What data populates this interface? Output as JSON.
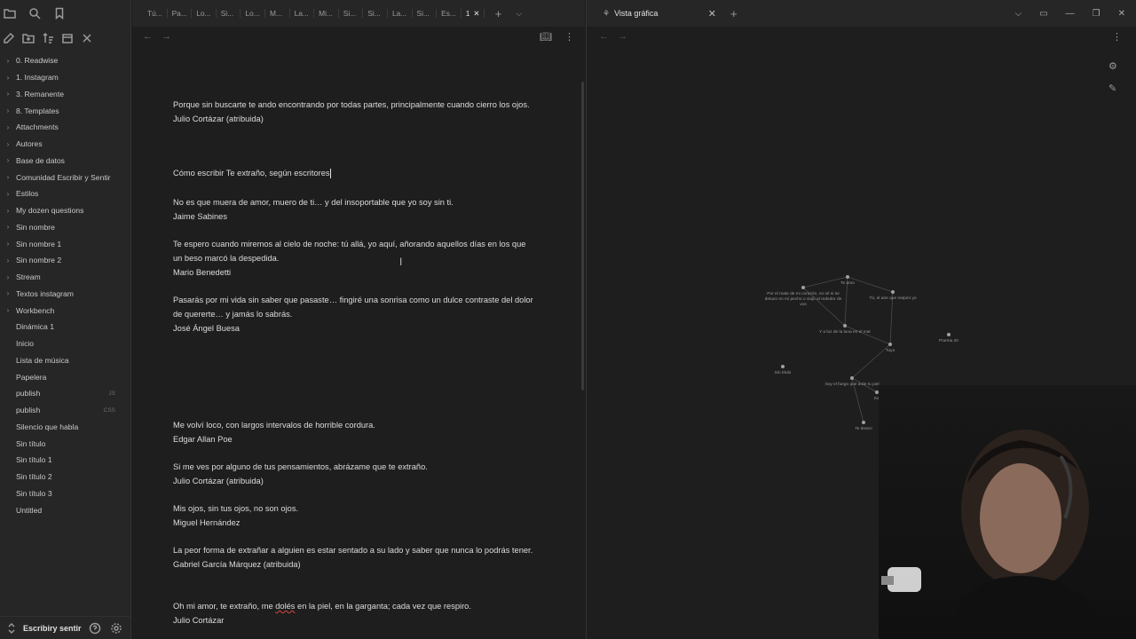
{
  "editor": {
    "tabs": [
      "Tú...",
      "Pa...",
      "Lo...",
      "Si...",
      "Lo...",
      "M...",
      "La...",
      "Mi...",
      "Si...",
      "Si...",
      "La...",
      "Si...",
      "Es..."
    ],
    "active_tab": "1",
    "heading": "Cómo escribir Te extraño, según escritores",
    "paragraphs": [
      {
        "lines": [
          "Porque sin buscarte te ando encontrando por todas partes, principalmente cuando cierro los ojos.",
          "Julio Cortázar (atribuida)"
        ]
      },
      {
        "lines": [
          "No es que muera de amor, muero de ti… y del insoportable que yo soy sin ti.",
          "Jaime Sabines"
        ]
      },
      {
        "lines": [
          "Te espero cuando miremos al cielo de noche: tú allá, yo aquí, añorando aquellos días en los que un beso marcó la despedida.",
          "Mario Benedetti"
        ]
      },
      {
        "lines": [
          "Pasarás por mi vida sin saber que pasaste… fingiré una sonrisa como un dulce contraste del dolor de quererte… y jamás lo sabrás.",
          "José Ángel Buesa"
        ]
      },
      {
        "lines": [
          "Me volví loco, con largos intervalos de horrible cordura.",
          "Edgar Allan Poe"
        ]
      },
      {
        "lines": [
          "Si me ves por alguno de tus pensamientos, abrázame que te extraño.",
          "Julio Cortázar (atribuida)"
        ]
      },
      {
        "lines": [
          "Mis ojos, sin tus ojos, no son ojos.",
          "Miguel Hernández"
        ]
      },
      {
        "lines": [
          "La peor forma de extrañar a alguien es estar sentado a su lado y saber que nunca lo podrás tener.",
          "Gabriel García Márquez (atribuida)"
        ]
      },
      {
        "lines_html": true,
        "line1_pre": "Oh mi amor, te extraño, me ",
        "line1_spell": "dolés",
        "line1_post": " en la piel, en la garganta; cada vez que respiro.",
        "author": "Julio Cortázar"
      }
    ]
  },
  "sidebar": {
    "folders": [
      "0. Readwise",
      "1. Instagram",
      "3. Remanente",
      "8. Templates",
      "Attachments",
      "Autores",
      "Base de datos",
      "Comunidad Escribir y Sentir",
      "Estilos",
      "My dozen questions",
      "Sin nombre",
      "Sin nombre 1",
      "Sin nombre 2",
      "Stream",
      "Textos instagram",
      "Workbench"
    ],
    "files": [
      {
        "name": "Dinámica 1",
        "ext": ""
      },
      {
        "name": "Inicio",
        "ext": ""
      },
      {
        "name": "Lista de música",
        "ext": ""
      },
      {
        "name": "Papelera",
        "ext": ""
      },
      {
        "name": "publish",
        "ext": "JS"
      },
      {
        "name": "publish",
        "ext": "CSS"
      },
      {
        "name": "Silencio que habla",
        "ext": ""
      },
      {
        "name": "Sin título",
        "ext": ""
      },
      {
        "name": "Sin título 1",
        "ext": ""
      },
      {
        "name": "Sin título 2",
        "ext": ""
      },
      {
        "name": "Sin título 3",
        "ext": ""
      },
      {
        "name": "Untitled",
        "ext": ""
      }
    ],
    "vault_name": "Escribiry sentir"
  },
  "graph": {
    "tab_title": "Vista gráfica",
    "nodes": [
      {
        "label": "Te amo"
      },
      {
        "label": "Por el mate de mi corazón, no sé si se detuvo en mi pecho o viajó al rededor de vos"
      },
      {
        "label": "Tú, el aire que respiro yo"
      },
      {
        "label": "Y a luz de la luna en el mar"
      },
      {
        "label": "Poema 20"
      },
      {
        "label": "Tuyo"
      },
      {
        "label": "Sin título"
      },
      {
        "label": "Soy el fuego que arde tu piel"
      },
      {
        "label": "Sol"
      },
      {
        "label": "Te deseo"
      }
    ]
  },
  "colors": {
    "background": "#1e1e1e",
    "sidebar": "#262626",
    "text": "#dcdcdc",
    "muted": "#9a9a9a"
  }
}
